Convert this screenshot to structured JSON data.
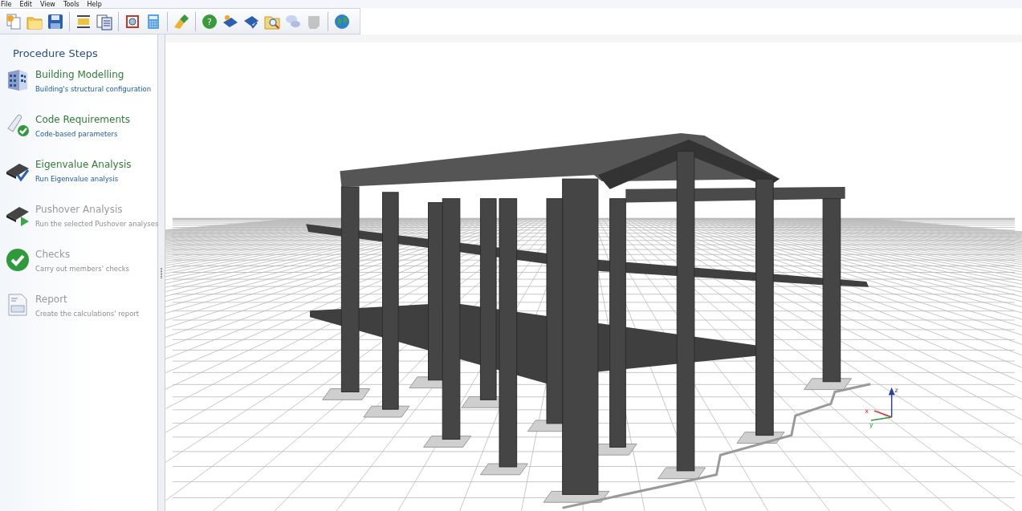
{
  "menu_bar": {
    "items": [
      "File",
      "Edit",
      "View",
      "Tools",
      "Help"
    ]
  },
  "toolbar": {
    "groups": [
      [
        {
          "kind": "new",
          "disabled": false
        },
        {
          "kind": "open",
          "disabled": false
        },
        {
          "kind": "save",
          "disabled": false
        }
      ],
      [
        {
          "kind": "frame",
          "disabled": false
        },
        {
          "kind": "pages",
          "disabled": false
        }
      ],
      [
        {
          "kind": "model",
          "disabled": false
        },
        {
          "kind": "calculator",
          "disabled": false
        }
      ],
      [
        {
          "kind": "brush",
          "disabled": false
        }
      ],
      [
        {
          "kind": "help",
          "label": "?",
          "disabled": false
        },
        {
          "kind": "book",
          "disabled": false
        },
        {
          "kind": "book-check",
          "disabled": false
        },
        {
          "kind": "search-folder",
          "disabled": false
        },
        {
          "kind": "chat",
          "disabled": false
        },
        {
          "kind": "shape",
          "disabled": true
        }
      ],
      [
        {
          "kind": "globe",
          "disabled": false
        }
      ]
    ]
  },
  "sidebar": {
    "title": "Procedure Steps",
    "items": [
      {
        "kind": "building",
        "title": "Building Modelling",
        "subtitle": "Building's structural configuration",
        "disabled": false
      },
      {
        "kind": "code",
        "title": "Code Requirements",
        "subtitle": "Code-based parameters",
        "disabled": false
      },
      {
        "kind": "eigen",
        "title": "Eigenvalue Analysis",
        "subtitle": "Run Eigenvalue analysis",
        "disabled": false
      },
      {
        "kind": "pushover",
        "title": "Pushover Analysis",
        "subtitle": "Run the selected Pushover analyses",
        "disabled": true
      },
      {
        "kind": "checks",
        "title": "Checks",
        "subtitle": "Carry out members' checks",
        "disabled": true
      },
      {
        "kind": "report",
        "title": "Report",
        "subtitle": "Create the calculations' report",
        "disabled": true
      }
    ]
  },
  "viewport": {
    "axes": {
      "x": "x",
      "y": "y",
      "z": "z"
    }
  }
}
